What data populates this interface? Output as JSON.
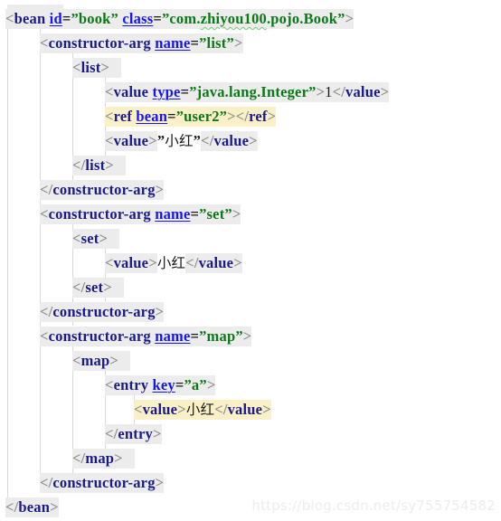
{
  "document": {
    "kind": "xml-code-listing",
    "language": "XML (Spring bean configuration)",
    "background_color": "#ffffff",
    "token_background_color": "#ececec",
    "highlight_background_color": "#faf0c8",
    "indent_guide_color": "#d8d8d8",
    "colors": {
      "bracket": "#8a8a8a",
      "tag_name": "#1a1a8c",
      "attribute_name": "#1414ff",
      "attribute_value": "#0b7a16",
      "text_content": "#1a1a1a"
    }
  },
  "clipped_top_line": {
    "visible": true,
    "description": "bottom sliver of a previous code line, clipped by the screenshot edge"
  },
  "code_lines": [
    {
      "id": "line-bean-open",
      "indent": 0,
      "highlighted": false,
      "text": "<bean id=\"book\" class=\"com.zhiyou100.pojo.Book\">",
      "tag": "bean",
      "attributes": [
        {
          "name": "id",
          "value": "book"
        },
        {
          "name": "class",
          "value": "com.zhiyou100.pojo.Book",
          "spellcheck_squiggle": true
        }
      ]
    },
    {
      "id": "line-carg-list-open",
      "indent": 1,
      "highlighted": false,
      "text": "<constructor-arg name=\"list\">",
      "tag": "constructor-arg",
      "attributes": [
        {
          "name": "name",
          "value": "list"
        }
      ]
    },
    {
      "id": "line-list-open",
      "indent": 2,
      "highlighted": false,
      "text": "<list>",
      "tag": "list",
      "attributes": []
    },
    {
      "id": "line-value-integer",
      "indent": 3,
      "highlighted": false,
      "text": "<value type=\"java.lang.Integer\">1</value>",
      "tag": "value",
      "attributes": [
        {
          "name": "type",
          "value": "java.lang.Integer"
        }
      ],
      "content": "1"
    },
    {
      "id": "line-ref-user2",
      "indent": 3,
      "highlighted": true,
      "text": "<ref bean=\"user2\"></ref>",
      "tag": "ref",
      "attributes": [
        {
          "name": "bean",
          "value": "user2"
        }
      ],
      "content": ""
    },
    {
      "id": "line-value-xiaohong-quoted",
      "indent": 3,
      "highlighted": false,
      "text": "<value>\"小红\"</value>",
      "tag": "value",
      "attributes": [],
      "content": "\"小红\""
    },
    {
      "id": "line-list-close",
      "indent": 2,
      "highlighted": false,
      "text": "</list>",
      "tag": "list",
      "attributes": []
    },
    {
      "id": "line-carg-list-close",
      "indent": 1,
      "highlighted": false,
      "text": "</constructor-arg>",
      "tag": "constructor-arg",
      "attributes": []
    },
    {
      "id": "line-carg-set-open",
      "indent": 1,
      "highlighted": false,
      "text": "<constructor-arg name=\"set\">",
      "tag": "constructor-arg",
      "attributes": [
        {
          "name": "name",
          "value": "set"
        }
      ]
    },
    {
      "id": "line-set-open",
      "indent": 2,
      "highlighted": false,
      "text": "<set>",
      "tag": "set",
      "attributes": []
    },
    {
      "id": "line-value-xiaohong-set",
      "indent": 3,
      "highlighted": false,
      "text": "<value>小红</value>",
      "tag": "value",
      "attributes": [],
      "content": "小红"
    },
    {
      "id": "line-set-close",
      "indent": 2,
      "highlighted": false,
      "text": "</set>",
      "tag": "set",
      "attributes": []
    },
    {
      "id": "line-carg-set-close",
      "indent": 1,
      "highlighted": false,
      "text": "</constructor-arg>",
      "tag": "constructor-arg",
      "attributes": []
    },
    {
      "id": "line-carg-map-open",
      "indent": 1,
      "highlighted": false,
      "text": "<constructor-arg name=\"map\">",
      "tag": "constructor-arg",
      "attributes": [
        {
          "name": "name",
          "value": "map"
        }
      ]
    },
    {
      "id": "line-map-open",
      "indent": 2,
      "highlighted": false,
      "text": "<map>",
      "tag": "map",
      "attributes": []
    },
    {
      "id": "line-entry-open",
      "indent": 3,
      "highlighted": false,
      "text": "<entry key=\"a\">",
      "tag": "entry",
      "attributes": [
        {
          "name": "key",
          "value": "a"
        }
      ]
    },
    {
      "id": "line-value-xiaohong-map",
      "indent": 4,
      "highlighted": true,
      "text": "<value>小红</value>",
      "tag": "value",
      "attributes": [],
      "content": "小红"
    },
    {
      "id": "line-entry-close",
      "indent": 3,
      "highlighted": false,
      "text": "</entry>",
      "tag": "entry",
      "attributes": []
    },
    {
      "id": "line-map-close",
      "indent": 2,
      "highlighted": false,
      "text": "</map>",
      "tag": "map",
      "attributes": []
    },
    {
      "id": "line-carg-map-close",
      "indent": 1,
      "highlighted": false,
      "text": "</constructor-arg>",
      "tag": "constructor-arg",
      "attributes": []
    },
    {
      "id": "line-bean-close",
      "indent": 0,
      "highlighted": false,
      "text": "</bean>",
      "tag": "bean",
      "attributes": []
    }
  ],
  "watermark": {
    "text": "https://blog.csdn.net/sy755754582",
    "color": "#ededed"
  }
}
